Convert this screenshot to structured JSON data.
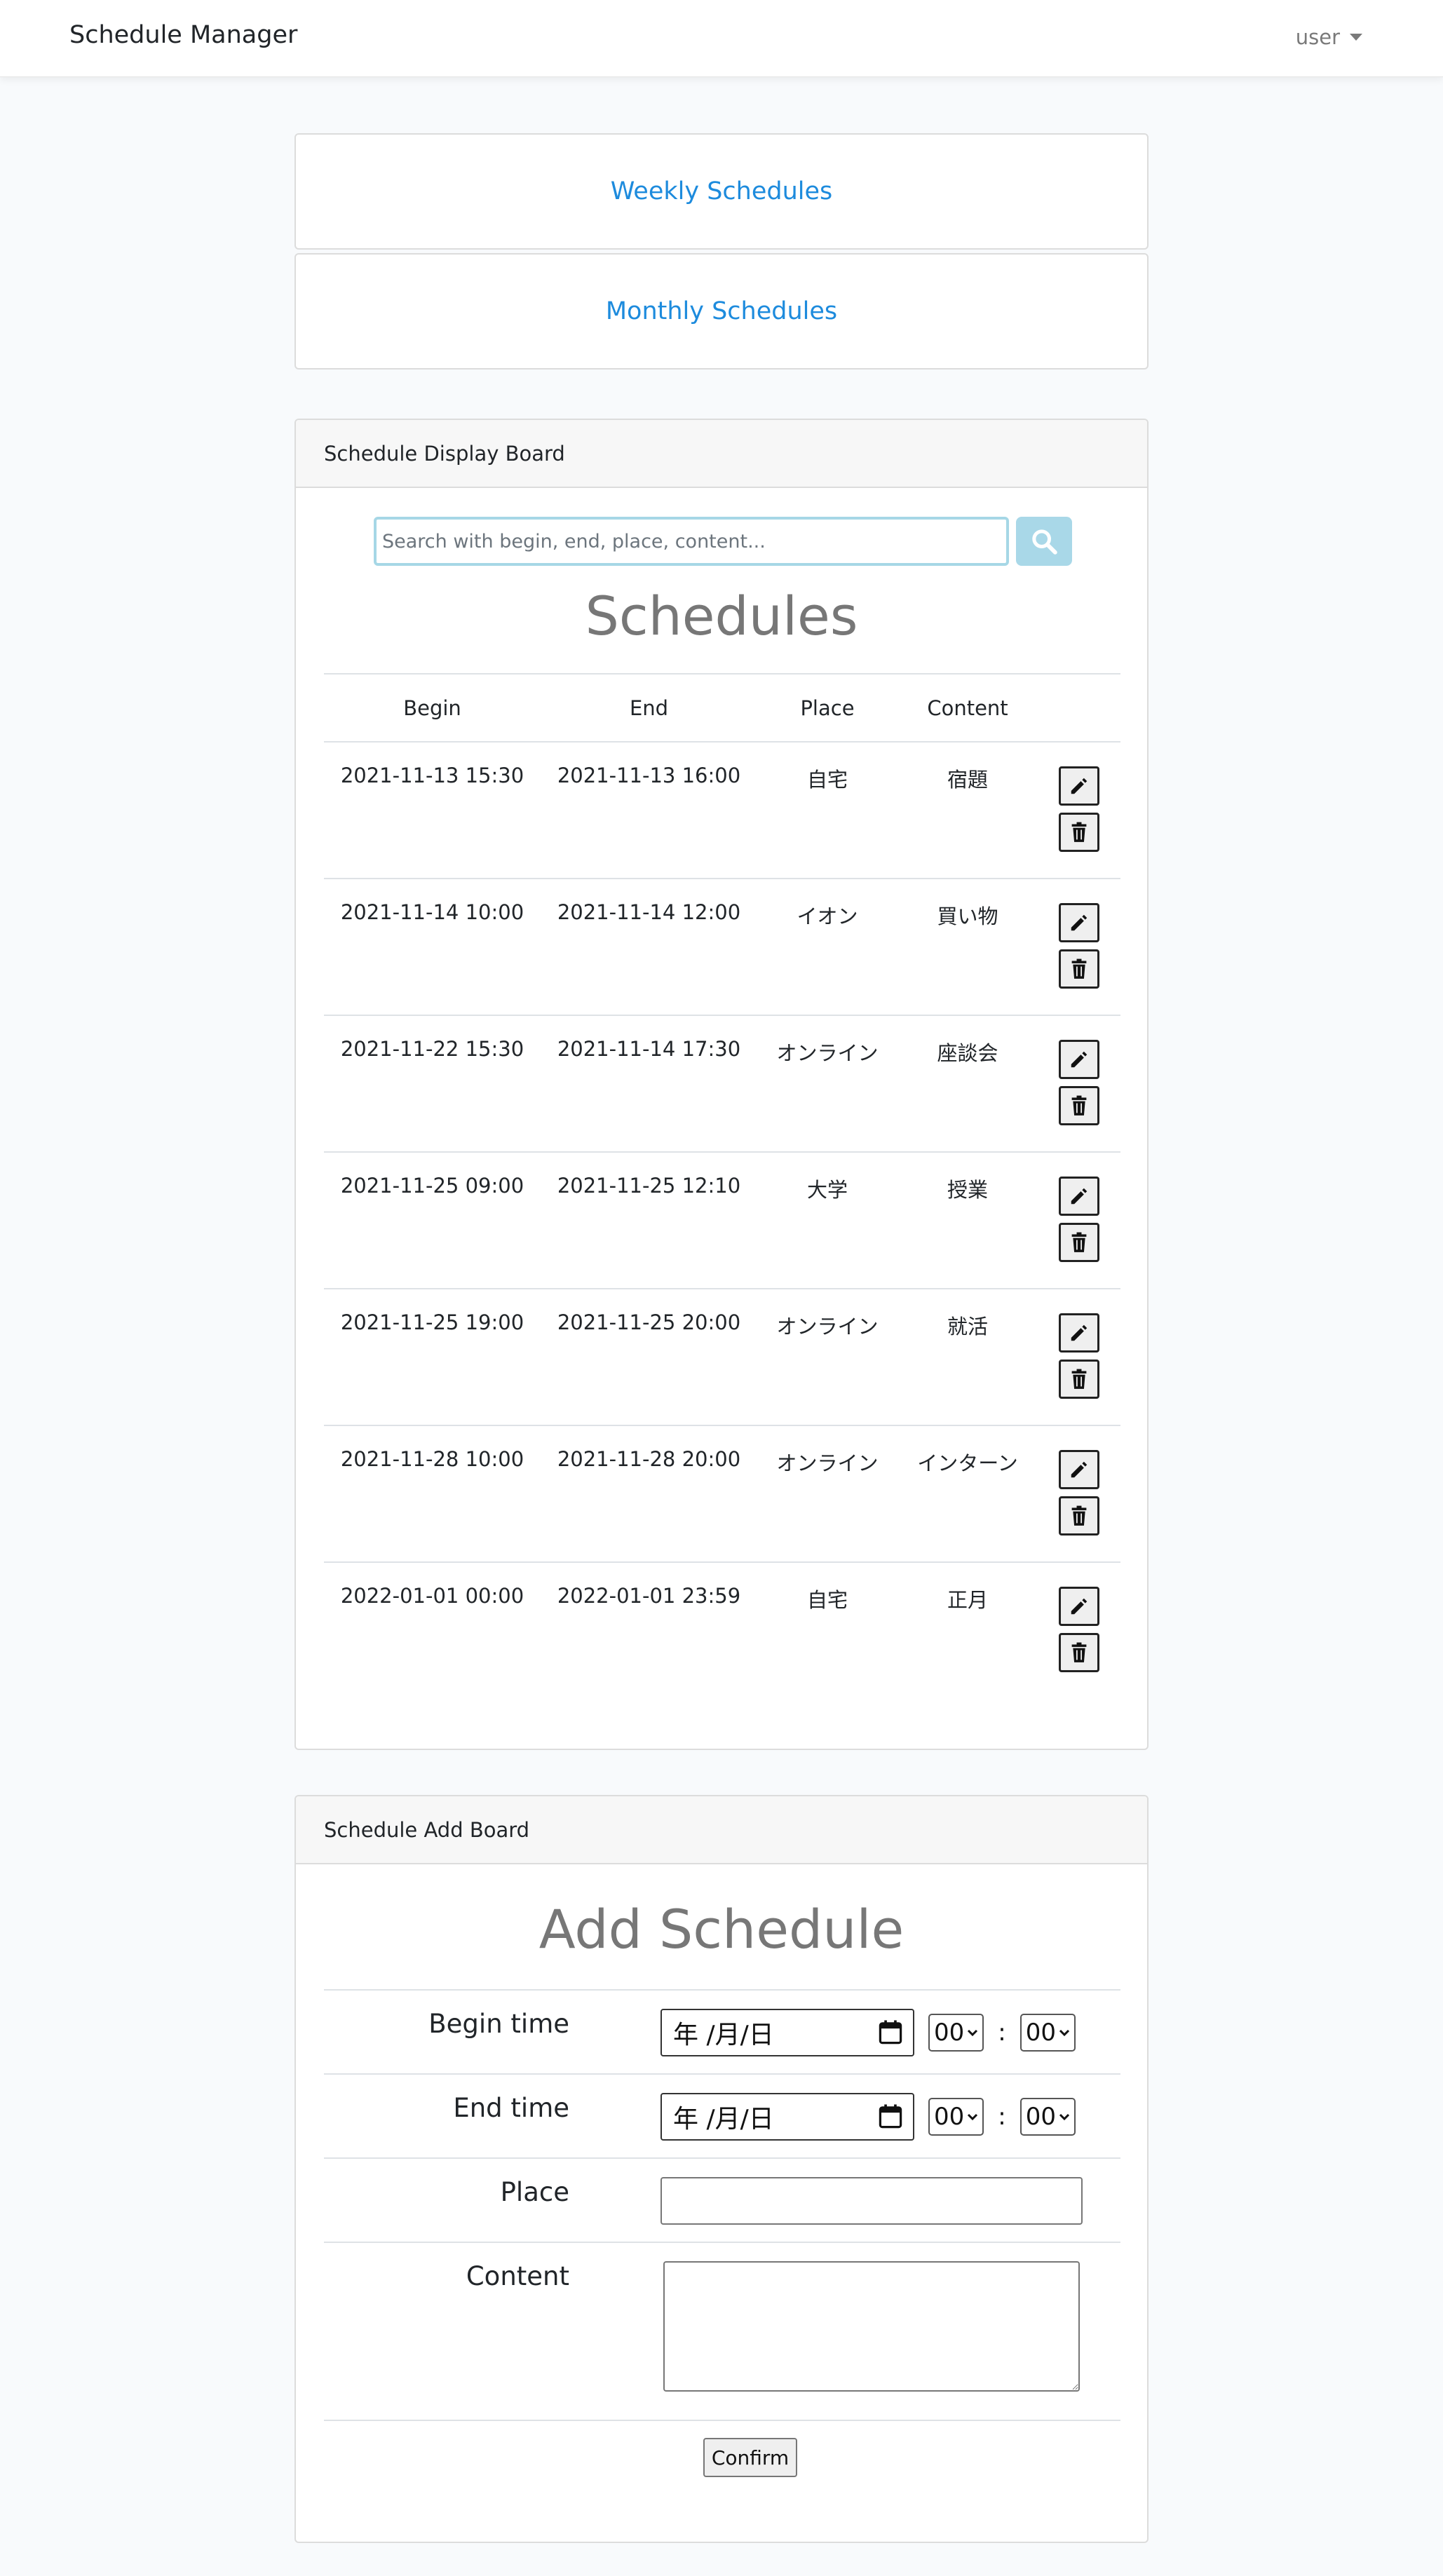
{
  "navbar": {
    "brand": "Schedule Manager",
    "user": "user"
  },
  "links": {
    "weekly": "Weekly Schedules",
    "monthly": "Monthly Schedules"
  },
  "display_board": {
    "header": "Schedule Display Board",
    "search_placeholder": "Search with begin, end, place, content...",
    "title": "Schedules",
    "columns": [
      "Begin",
      "End",
      "Place",
      "Content"
    ],
    "rows": [
      {
        "begin": "2021-11-13 15:30",
        "end": "2021-11-13 16:00",
        "place": "自宅",
        "content": "宿題"
      },
      {
        "begin": "2021-11-14 10:00",
        "end": "2021-11-14 12:00",
        "place": "イオン",
        "content": "買い物"
      },
      {
        "begin": "2021-11-22 15:30",
        "end": "2021-11-14 17:30",
        "place": "オンライン",
        "content": "座談会"
      },
      {
        "begin": "2021-11-25 09:00",
        "end": "2021-11-25 12:10",
        "place": "大学",
        "content": "授業"
      },
      {
        "begin": "2021-11-25 19:00",
        "end": "2021-11-25 20:00",
        "place": "オンライン",
        "content": "就活"
      },
      {
        "begin": "2021-11-28 10:00",
        "end": "2021-11-28 20:00",
        "place": "オンライン",
        "content": "インターン"
      },
      {
        "begin": "2022-01-01 00:00",
        "end": "2022-01-01 23:59",
        "place": "自宅",
        "content": "正月"
      }
    ]
  },
  "add_board": {
    "header": "Schedule Add Board",
    "title": "Add Schedule",
    "begin_label": "Begin time",
    "end_label": "End time",
    "place_label": "Place",
    "content_label": "Content",
    "date_placeholder": "年 /月/日",
    "hour_value": "00",
    "minute_value": "00",
    "colon": ":",
    "confirm_label": "Confirm"
  },
  "colors": {
    "link": "#1d8bdd",
    "search_border": "#a6d7e6",
    "search_button": "#a9d8e8"
  },
  "icons": {
    "search": "search-icon",
    "edit": "pencil-icon",
    "delete": "trash-icon",
    "calendar": "calendar-icon"
  }
}
